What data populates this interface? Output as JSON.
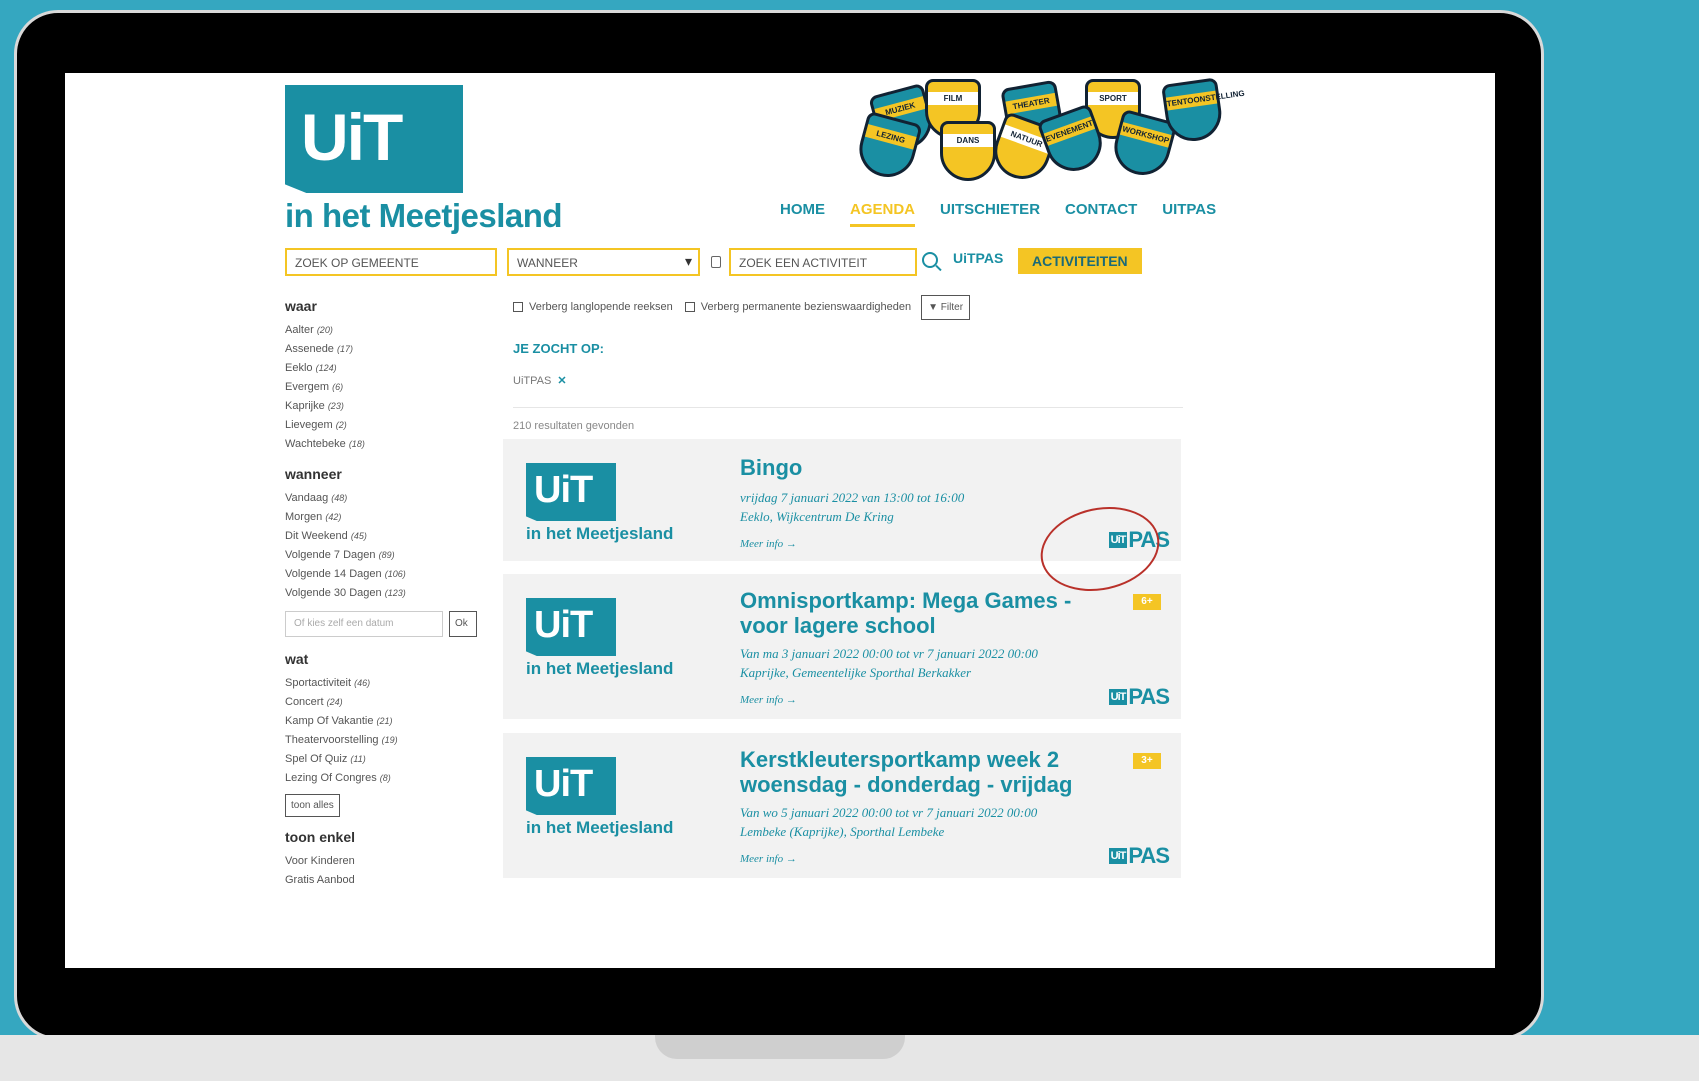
{
  "site": {
    "logo_uit": "UiT",
    "logo_sub": "in het Meetjesland",
    "badges": [
      "MUZIEK",
      "FILM",
      "THEATER",
      "SPORT",
      "LEZING",
      "DANS",
      "NATUUR",
      "EVENEMENT",
      "WORKSHOP",
      "TENTOONSTELLING"
    ]
  },
  "nav": {
    "home": "HOME",
    "agenda": "AGENDA",
    "uitschieter": "UITSCHIETER",
    "contact": "CONTACT",
    "uitpas": "UITPAS"
  },
  "search": {
    "gemeente_placeholder": "ZOEK OP GEMEENTE",
    "wanneer_value": "WANNEER",
    "activiteit_placeholder": "ZOEK EEN ACTIVITEIT",
    "uitpas_mini": "UiTPAS",
    "activiteiten_button": "ACTIVITEITEN"
  },
  "sidebar": {
    "waar": {
      "title": "waar",
      "items": [
        {
          "label": "Aalter",
          "count": "(20)"
        },
        {
          "label": "Assenede",
          "count": "(17)"
        },
        {
          "label": "Eeklo",
          "count": "(124)"
        },
        {
          "label": "Evergem",
          "count": "(6)"
        },
        {
          "label": "Kaprijke",
          "count": "(23)"
        },
        {
          "label": "Lievegem",
          "count": "(2)"
        },
        {
          "label": "Wachtebeke",
          "count": "(18)"
        }
      ]
    },
    "wanneer": {
      "title": "wanneer",
      "items": [
        {
          "label": "Vandaag",
          "count": "(48)"
        },
        {
          "label": "Morgen",
          "count": "(42)"
        },
        {
          "label": "Dit Weekend",
          "count": "(45)"
        },
        {
          "label": "Volgende 7 Dagen",
          "count": "(89)"
        },
        {
          "label": "Volgende 14 Dagen",
          "count": "(106)"
        },
        {
          "label": "Volgende 30 Dagen",
          "count": "(123)"
        }
      ],
      "date_placeholder": "Of kies zelf een datum",
      "ok": "Ok"
    },
    "wat": {
      "title": "wat",
      "items": [
        {
          "label": "Sportactiviteit",
          "count": "(46)"
        },
        {
          "label": "Concert",
          "count": "(24)"
        },
        {
          "label": "Kamp Of Vakantie",
          "count": "(21)"
        },
        {
          "label": "Theatervoorstelling",
          "count": "(19)"
        },
        {
          "label": "Spel Of Quiz",
          "count": "(11)"
        },
        {
          "label": "Lezing Of Congres",
          "count": "(8)"
        }
      ],
      "toon_alles": "toon alles"
    },
    "toon_enkel": {
      "title": "toon enkel",
      "items": [
        "Voor Kinderen",
        "Gratis Aanbod"
      ]
    }
  },
  "main": {
    "cb1": "Verberg langlopende reeksen",
    "cb2": "Verberg permanente bezienswaardigheden",
    "filter": "Filter",
    "zocht": "JE ZOCHT OP:",
    "tag": "UiTPAS",
    "tag_remove": "✕",
    "results": "210 resultaten gevonden"
  },
  "cards": [
    {
      "title": "Bingo",
      "when": "vrijdag 7 januari 2022 van 13:00 tot 16:00",
      "where": "Eeklo, Wijkcentrum De Kring",
      "info": "Meer info →",
      "age": ""
    },
    {
      "title": "Omnisportkamp: Mega Games - voor lagere school",
      "when": "Van ma 3 januari 2022 00:00 tot vr 7 januari 2022 00:00",
      "where": "Kaprijke, Gemeentelijke Sporthal Berkakker",
      "info": "Meer info →",
      "age": "6+"
    },
    {
      "title": "Kerstkleutersportkamp week 2 woensdag - donderdag - vrijdag",
      "when": "Van wo 5 januari 2022 00:00 tot vr 7 januari 2022 00:00",
      "where": "Lembeke (Kaprijke), Sporthal Lembeke",
      "info": "Meer info →",
      "age": "3+"
    }
  ],
  "pas": {
    "uit": "UiT",
    "pas": "PAS"
  }
}
